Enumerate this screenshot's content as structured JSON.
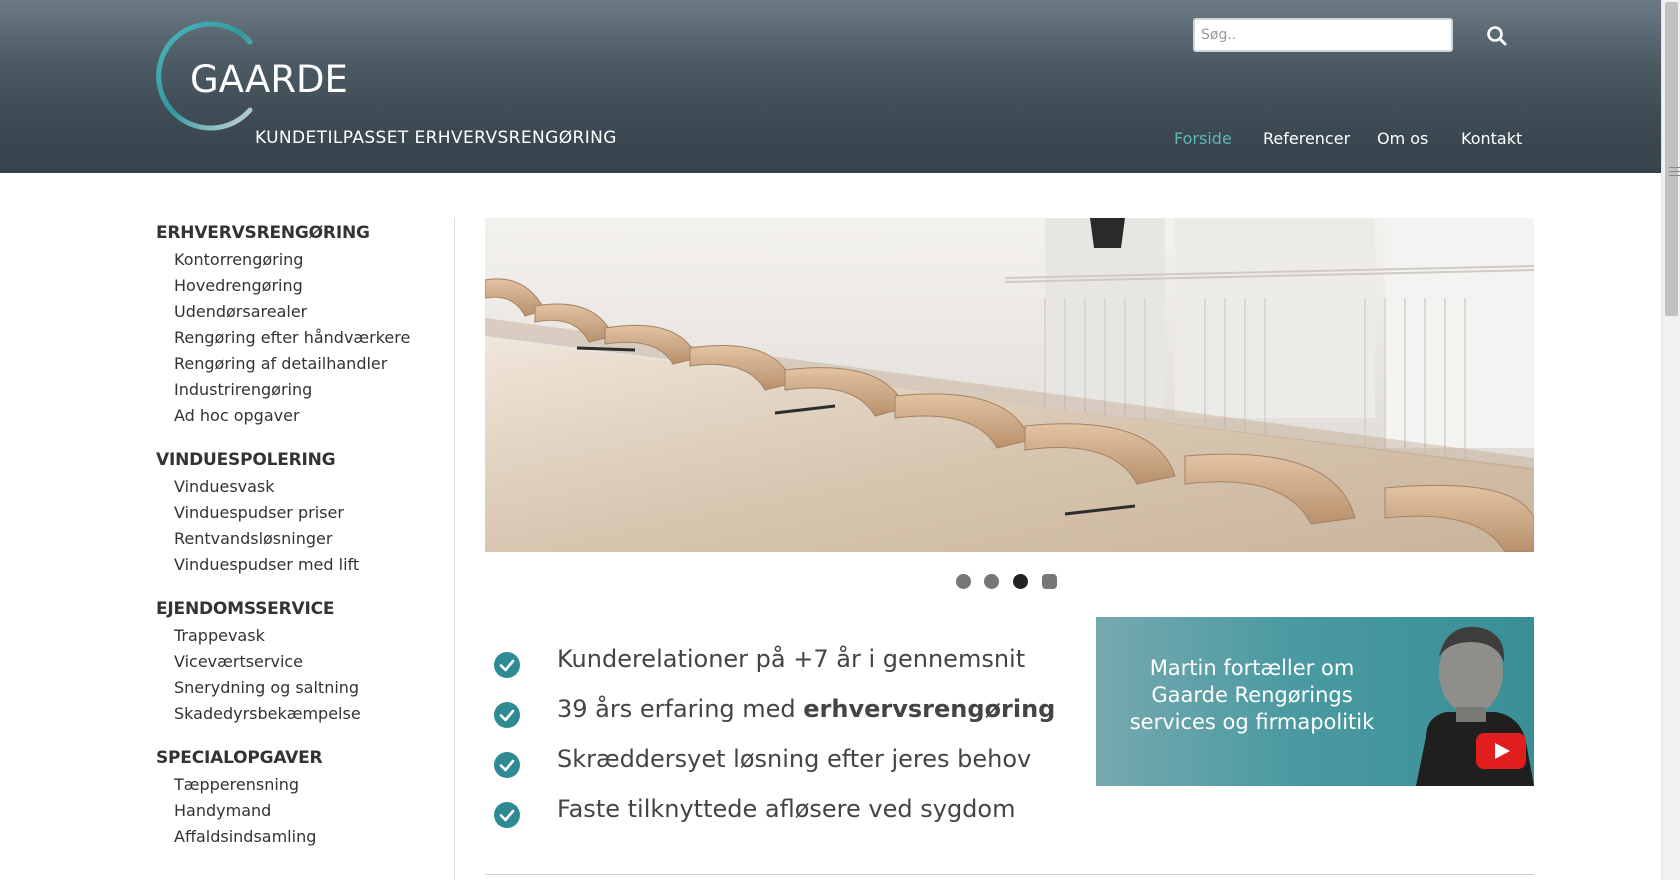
{
  "header": {
    "logo_name": "GAARDE",
    "logo_tagline": "KUNDETILPASSET ERHVERVSRENGØRING",
    "search_placeholder": "Søg..",
    "search_icon": "search-icon",
    "nav": [
      {
        "label": "Forside",
        "active": true
      },
      {
        "label": "Referencer",
        "active": false
      },
      {
        "label": "Om os",
        "active": false
      },
      {
        "label": "Kontakt",
        "active": false
      }
    ],
    "colors": {
      "header_dark": "#36434c",
      "header_light": "#6b7a84",
      "active_nav": "#5fb5b8"
    }
  },
  "sidebar": {
    "sections": [
      {
        "title": "ERHVERVSRENGØRING",
        "items": [
          "Kontorrengøring",
          "Hovedrengøring",
          "Udendørsarealer",
          "Rengøring efter håndværkere",
          "Rengøring af detailhandler",
          "Industrirengøring",
          "Ad hoc opgaver"
        ]
      },
      {
        "title": "VINDUESPOLERING",
        "items": [
          "Vinduesvask",
          "Vinduespudser priser",
          "Rentvandsløsninger",
          "Vinduespudser med lift"
        ]
      },
      {
        "title": "EJENDOMSSERVICE",
        "items": [
          "Trappevask",
          "Viceværtservice",
          "Snerydning og saltning",
          "Skadedyrsbekæmpelse"
        ]
      },
      {
        "title": "SPECIALOPGAVER",
        "items": [
          "Tæpperensning",
          "Handymand",
          "Affaldsindsamling"
        ]
      }
    ]
  },
  "slider": {
    "total_slides": 4,
    "active_slide": 3
  },
  "features": [
    {
      "text": "Kunderelationer på +7 år i gennemsnit",
      "bold": ""
    },
    {
      "text": "39 års erfaring med ",
      "bold": "erhvervsrengøring"
    },
    {
      "text": "Skræddersyet løsning efter jeres behov",
      "bold": ""
    },
    {
      "text": "Faste tilknyttede afløsere ved sygdom",
      "bold": ""
    }
  ],
  "video": {
    "lines": [
      "Martin fortæller om",
      "Gaarde Rengørings",
      "services og firmapolitik"
    ],
    "play_icon": "youtube-play-icon",
    "colors": {
      "teal": "#4a9aa1",
      "play_red": "#e01e1e"
    }
  },
  "colors": {
    "check_teal": "#2f8b93"
  }
}
